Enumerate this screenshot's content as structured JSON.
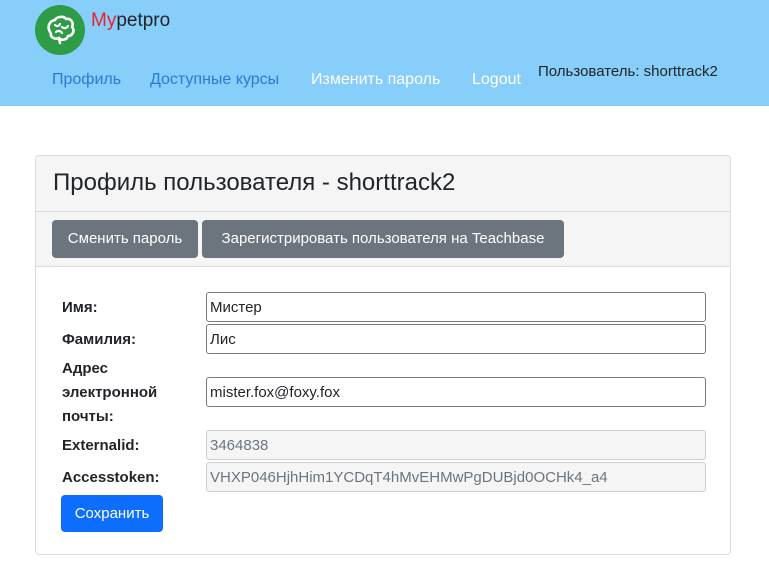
{
  "brand": {
    "accent": "My",
    "rest": "petpro"
  },
  "nav": {
    "profile": "Профиль",
    "courses": "Доступные курсы",
    "change_password": "Изменить пароль",
    "logout": "Logout",
    "user": "Пользователь: shorttrack2"
  },
  "card": {
    "title": "Профиль пользователя - shorttrack2",
    "change_password_button": "Сменить пароль",
    "register_button": "Зарегистрировать пользователя на Teachbase"
  },
  "form": {
    "first_name": {
      "label": "Имя:",
      "value": "Мистер"
    },
    "last_name": {
      "label": "Фамилия:",
      "value": "Лис"
    },
    "email": {
      "label_line1": "Адрес",
      "label_line2": "электронной",
      "label_line3": "почты:",
      "value": "mister.fox@foxy.fox"
    },
    "external_id": {
      "label": "Externalid:",
      "value": "3464838"
    },
    "access_token": {
      "label": "Accesstoken:",
      "value": "VHXP046HjhHim1YCDqT4hMvEHMwPgDUBjd0OCHk4_a4"
    },
    "save_button": "Сохранить"
  },
  "colors": {
    "navbar": "#87cefa",
    "logo": "#2e9b47",
    "brand_accent": "#e8242a",
    "primary": "#0d6efd",
    "secondary": "#6c757d",
    "link": "#2a7ad8"
  },
  "icons": {
    "logo": "brain-icon"
  }
}
